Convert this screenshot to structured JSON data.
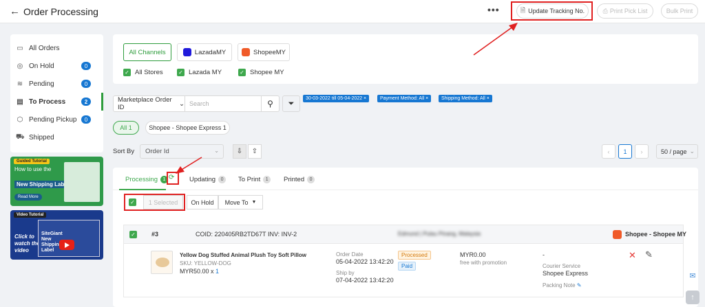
{
  "header": {
    "title": "Order Processing",
    "more_label": "•••",
    "update_tracking": "Update Tracking No.",
    "print_pick_list": "Print Pick List",
    "bulk_print": "Bulk Print"
  },
  "sidebar": {
    "items": [
      {
        "label": "All Orders",
        "icon": "inbox-icon"
      },
      {
        "label": "On Hold",
        "icon": "pause-circle-icon",
        "count": "0"
      },
      {
        "label": "Pending",
        "icon": "layers-icon",
        "count": "0"
      },
      {
        "label": "To Process",
        "icon": "clipboard-icon",
        "count": "2"
      },
      {
        "label": "Pending Pickup",
        "icon": "box-icon",
        "count": "0"
      },
      {
        "label": "Shipped",
        "icon": "truck-icon"
      }
    ]
  },
  "promos": {
    "guided": {
      "tag": "Guided Tutorial",
      "line1": "How to use the",
      "bold": "New Shipping Label?",
      "read_more": "Read More"
    },
    "video": {
      "tag": "Video Tutorial",
      "text": "Click to watch the video",
      "vtitle": "SiteGiant New Shipping Label"
    }
  },
  "channels": {
    "buttons": [
      "All Channels",
      "LazadaMY",
      "ShopeeMY"
    ],
    "stores": [
      "All Stores",
      "Lazada MY",
      "Shopee MY"
    ]
  },
  "search": {
    "field": "Marketplace Order ID",
    "placeholder": "Search"
  },
  "chips": [
    "30-03-2022 till 05-04-2022 ×",
    "Payment Method: All ×",
    "Shipping Method: All ×"
  ],
  "pills": [
    "All 1",
    "Shopee - Shopee Express 1"
  ],
  "sort": {
    "label": "Sort By",
    "value": "Order Id",
    "page": "1",
    "per_page": "50 / page"
  },
  "tabs": [
    {
      "label": "Processing",
      "count": "1"
    },
    {
      "label": "Updating",
      "count": "0"
    },
    {
      "label": "To Print",
      "count": "1"
    },
    {
      "label": "Printed",
      "count": "0"
    }
  ],
  "bulk": {
    "selected": "1 Selected",
    "on_hold": "On Hold",
    "move_to": "Move To"
  },
  "order": {
    "number": "#3",
    "coid": "COID: 220405RB2TD67T",
    "inv": "INV: INV-2",
    "customer": "Edmund | Pulau Pinang, Malaysia",
    "shop": "Shopee - Shopee MY",
    "product_name": "Yellow Dog Stuffed Animal Plush Toy Soft Pillow",
    "sku": "SKU: YELLOW-DOG",
    "price_qty": "MYR50.00 x",
    "qty": "1",
    "order_date_label": "Order Date",
    "order_date": "05-04-2022 13:42:20",
    "ship_by_label": "Ship by",
    "ship_by": "07-04-2022 13:42:20",
    "status1": "Processed",
    "status2": "Paid",
    "amount": "MYR0.00",
    "promo": "free with promotion",
    "dash": "-",
    "courier_label": "Courier Service",
    "courier": "Shopee Express",
    "packing_note": "Packing Note"
  }
}
